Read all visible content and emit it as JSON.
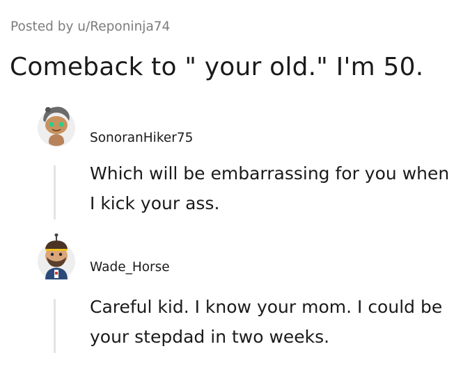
{
  "post": {
    "posted_by": "Posted by u/Reponinja74",
    "title": "Comeback to \" your old.\" I'm 50."
  },
  "comments": [
    {
      "avatar_icon": "snoo-avatar-gray-hair-green-eyes-icon",
      "username": "SonoranHiker75",
      "body": "Which will be embarrassing for you when I kick your ass."
    },
    {
      "avatar_icon": "snoo-avatar-headband-beard-icon",
      "username": "Wade_Horse",
      "body": "Careful kid. I know your mom. I could be your stepdad in two weeks."
    }
  ],
  "colors": {
    "text": "#1a1a1b",
    "meta": "#7c7c7c",
    "thread_line": "#e3e3e3"
  }
}
